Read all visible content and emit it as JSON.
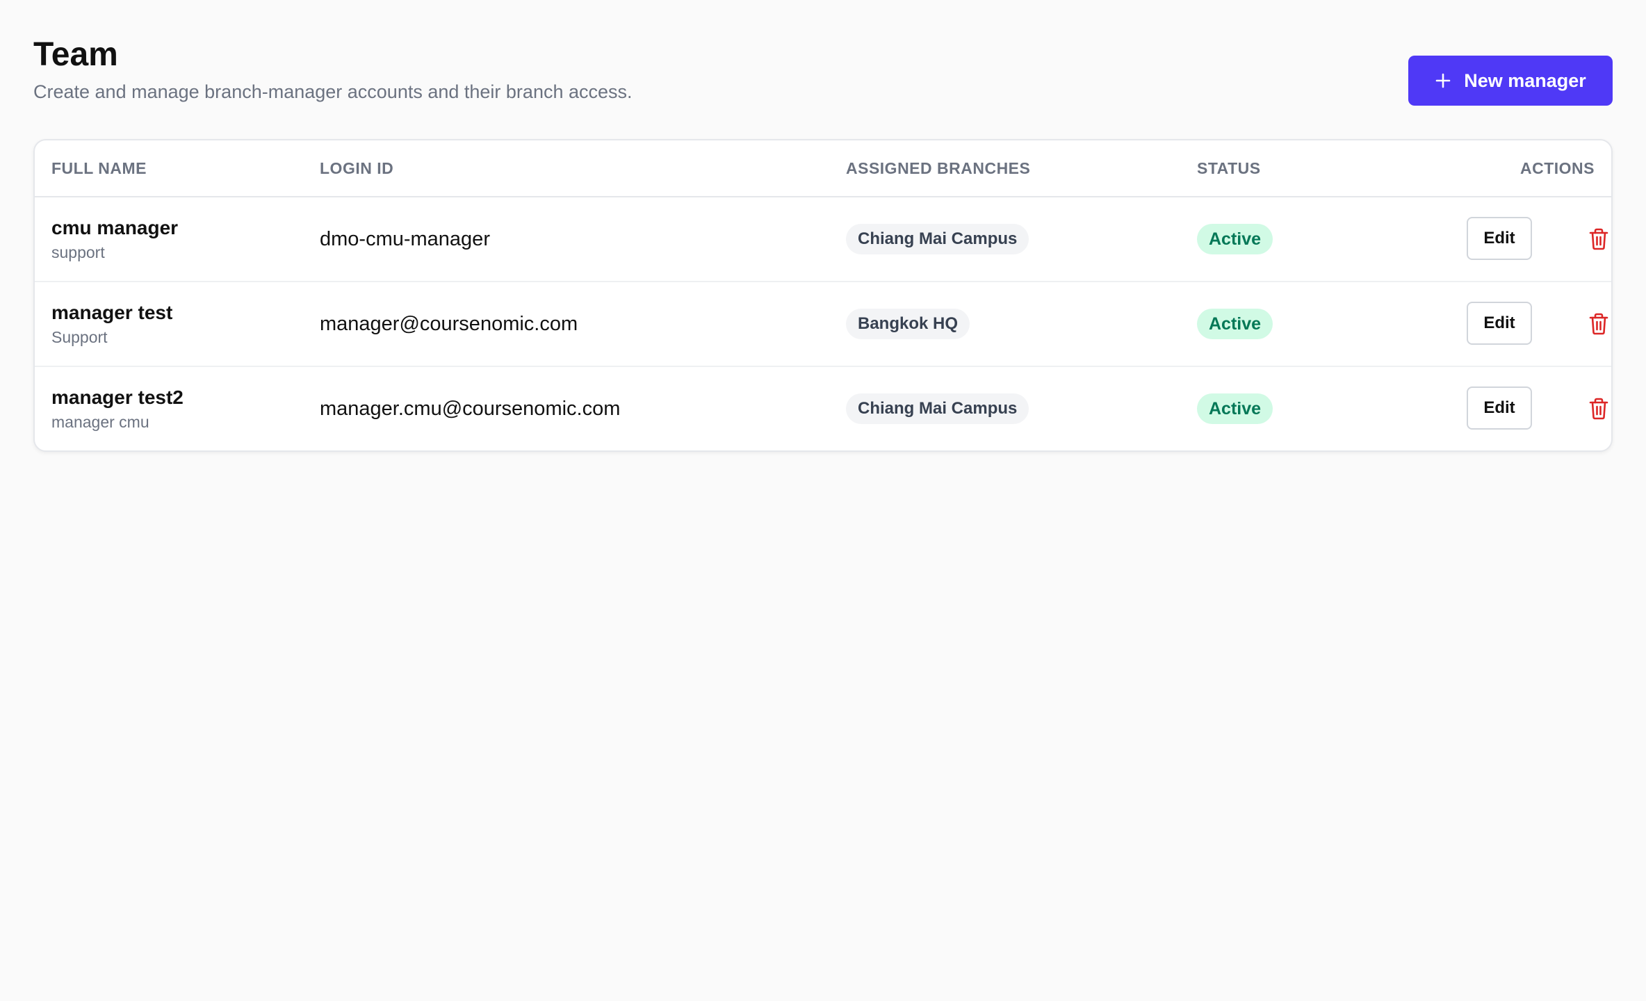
{
  "header": {
    "title": "Team",
    "subtitle": "Create and manage branch-manager accounts and their branch access.",
    "new_button_label": "New manager"
  },
  "table": {
    "columns": [
      "FULL NAME",
      "LOGIN ID",
      "ASSIGNED BRANCHES",
      "STATUS",
      "ACTIONS"
    ],
    "rows": [
      {
        "full_name": "cmu manager",
        "role": "support",
        "login_id": "dmo-cmu-manager",
        "branch": "Chiang Mai Campus",
        "status": "Active",
        "edit_label": "Edit"
      },
      {
        "full_name": "manager test",
        "role": "Support",
        "login_id": "manager@coursenomic.com",
        "branch": "Bangkok HQ",
        "status": "Active",
        "edit_label": "Edit"
      },
      {
        "full_name": "manager test2",
        "role": "manager cmu",
        "login_id": "manager.cmu@coursenomic.com",
        "branch": "Chiang Mai Campus",
        "status": "Active",
        "edit_label": "Edit"
      }
    ]
  },
  "colors": {
    "accent": "#4f39f6",
    "status_active_bg": "#d1fae5",
    "status_active_text": "#047857",
    "delete": "#dc2626"
  },
  "icons": {
    "new_button": "plus-icon",
    "delete": "trash-icon"
  }
}
